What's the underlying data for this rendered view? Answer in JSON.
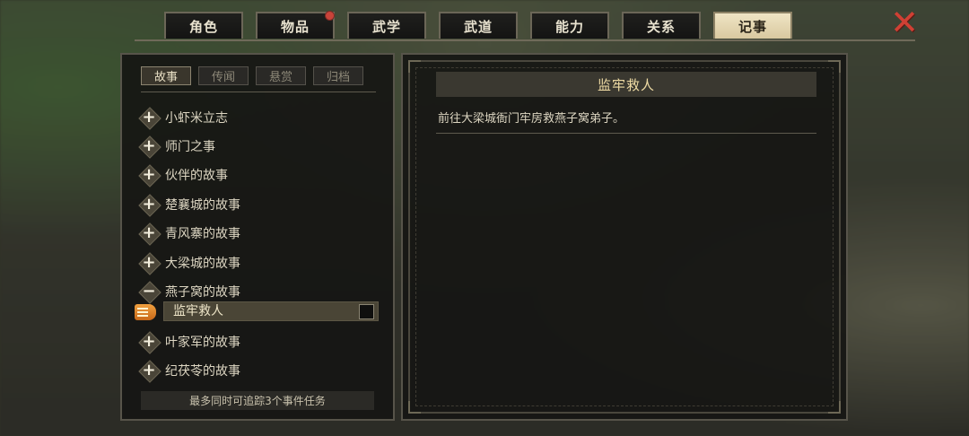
{
  "tabs": [
    {
      "label": "角色"
    },
    {
      "label": "物品"
    },
    {
      "label": "武学"
    },
    {
      "label": "武道"
    },
    {
      "label": "能力"
    },
    {
      "label": "关系"
    },
    {
      "label": "记事"
    }
  ],
  "active_tab": "记事",
  "close_icon": "close-x-icon",
  "journal": {
    "subtabs": [
      {
        "label": "故事"
      },
      {
        "label": "传闻"
      },
      {
        "label": "悬赏"
      },
      {
        "label": "归档"
      }
    ],
    "items": [
      {
        "label": "小虾米立志",
        "sign": "+"
      },
      {
        "label": "师门之事",
        "sign": "+"
      },
      {
        "label": "伙伴的故事",
        "sign": "+"
      },
      {
        "label": "楚襄城的故事",
        "sign": "+"
      },
      {
        "label": "青风寨的故事",
        "sign": "+"
      },
      {
        "label": "大梁城的故事",
        "sign": "+"
      },
      {
        "label": "燕子窝的故事",
        "sign": "−"
      }
    ],
    "selected_quest": "监牢救人",
    "items_after": [
      {
        "label": "叶家军的故事",
        "sign": "+"
      },
      {
        "label": "纪茯苓的故事",
        "sign": "+"
      }
    ],
    "footer": "最多同时可追踪3个事件任务"
  },
  "detail": {
    "title": "监牢救人",
    "description": "前往大梁城衙门牢房救燕子窝弟子。"
  },
  "colors": {
    "accent_gold": "#efdba4",
    "close_red": "#d04034",
    "notification_red": "#c8443a"
  }
}
